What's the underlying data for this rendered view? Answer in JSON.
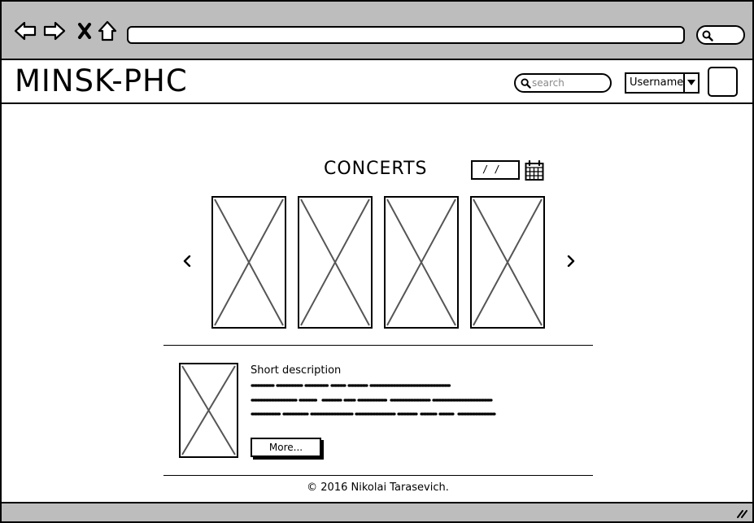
{
  "browser": {
    "icons": [
      "back-arrow-icon",
      "forward-arrow-icon",
      "close-x-icon",
      "home-icon",
      "search-icon"
    ]
  },
  "header": {
    "logo": "MINSK-PHC",
    "search_placeholder": "search",
    "user_label": "Username"
  },
  "main": {
    "title": "CONCERTS",
    "date_value": "/ /",
    "carousel_items": 4,
    "description_title": "Short description",
    "more_label": "More..."
  },
  "footer": {
    "copyright": "© 2016 Nikolai Tarasevich."
  }
}
